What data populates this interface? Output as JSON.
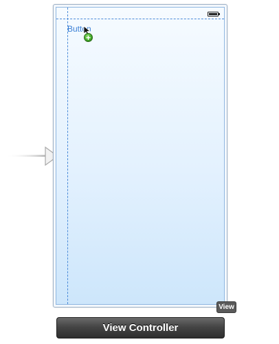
{
  "scene": {
    "button_label": "Button",
    "view_badge": "View",
    "controller_title": "View Controller"
  },
  "icons": {
    "entry_point": "arrow-right-icon",
    "battery": "battery-icon",
    "cursor": "pointer-cursor-icon",
    "add": "plus-icon"
  },
  "colors": {
    "guide": "#4a8ad8",
    "button_text": "#3a7fd6",
    "add_badge": "#3ea624",
    "controller_bar": "#3a3a3a"
  }
}
